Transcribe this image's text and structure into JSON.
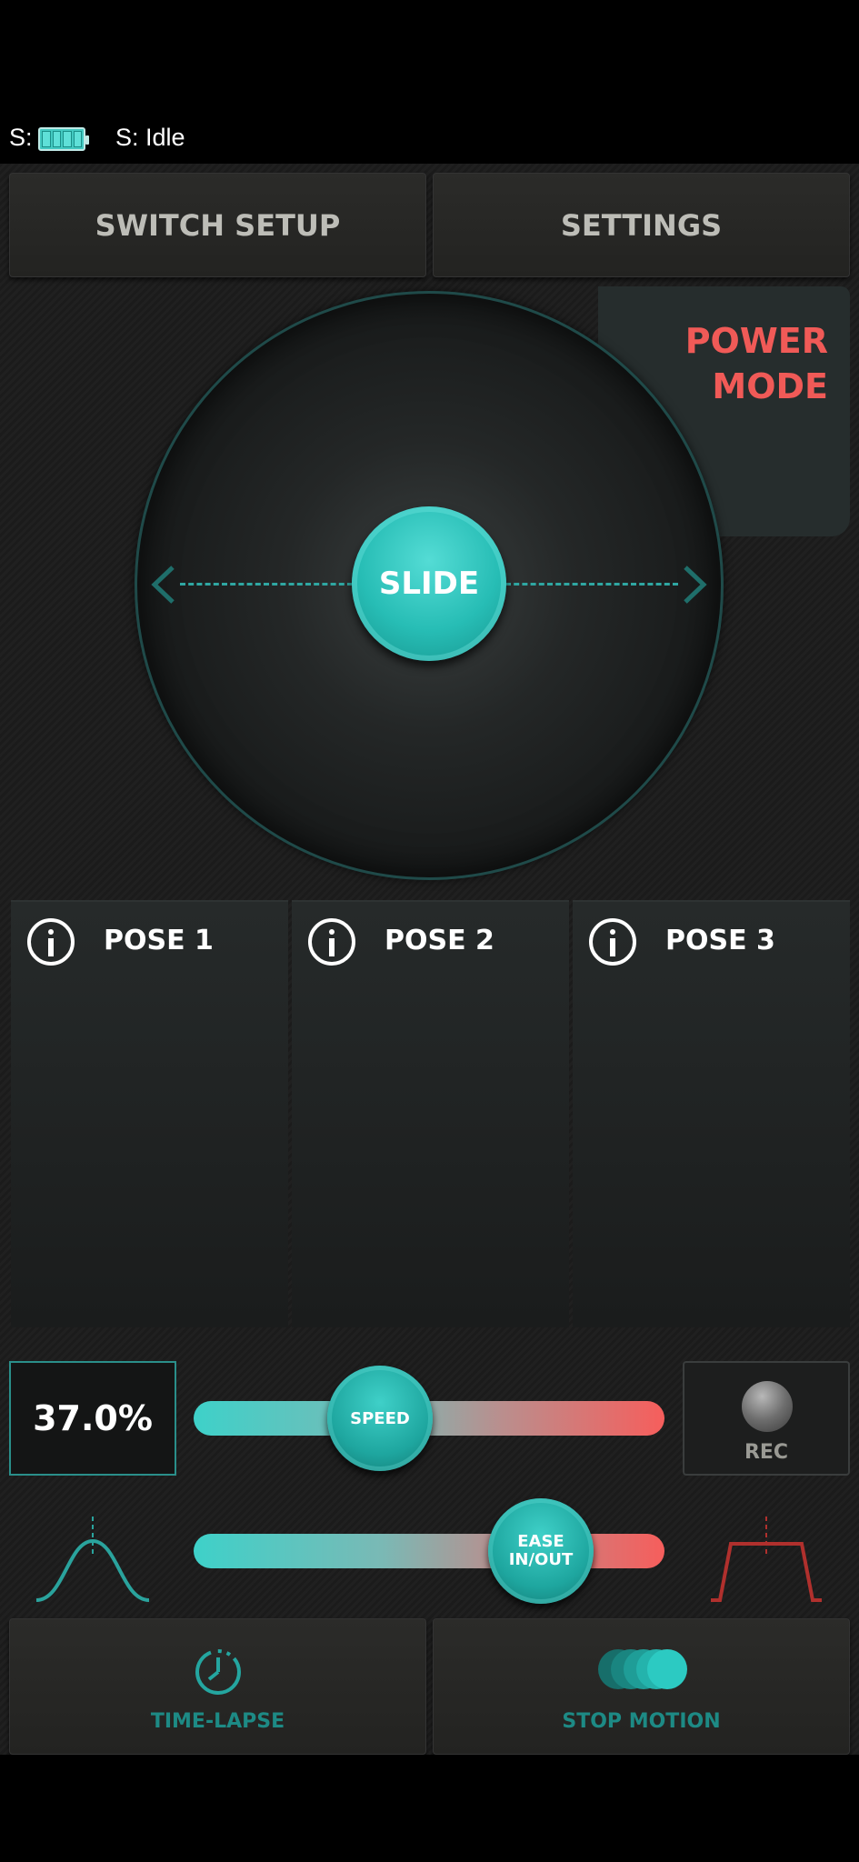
{
  "status": {
    "battery_prefix": "S:",
    "state": "S: Idle"
  },
  "top_buttons": {
    "switch_setup": "SWITCH SETUP",
    "settings": "SETTINGS"
  },
  "joystick": {
    "power_mode_line1": "POWER",
    "power_mode_line2": "MODE",
    "slide_label": "SLIDE"
  },
  "poses": [
    {
      "label": "POSE 1"
    },
    {
      "label": "POSE 2"
    },
    {
      "label": "POSE 3"
    }
  ],
  "controls": {
    "percent": "37.0%",
    "speed_label": "SPEED",
    "speed_value": 0.39,
    "ease_label_line1": "EASE",
    "ease_label_line2": "IN/OUT",
    "ease_value": 0.74,
    "rec_label": "REC"
  },
  "bottom_buttons": {
    "time_lapse": "TIME-LAPSE",
    "stop_motion": "STOP MOTION"
  },
  "colors": {
    "accent_teal": "#2cc3bb",
    "power_red": "#f05a57",
    "label_grey": "#bdbdb7"
  }
}
